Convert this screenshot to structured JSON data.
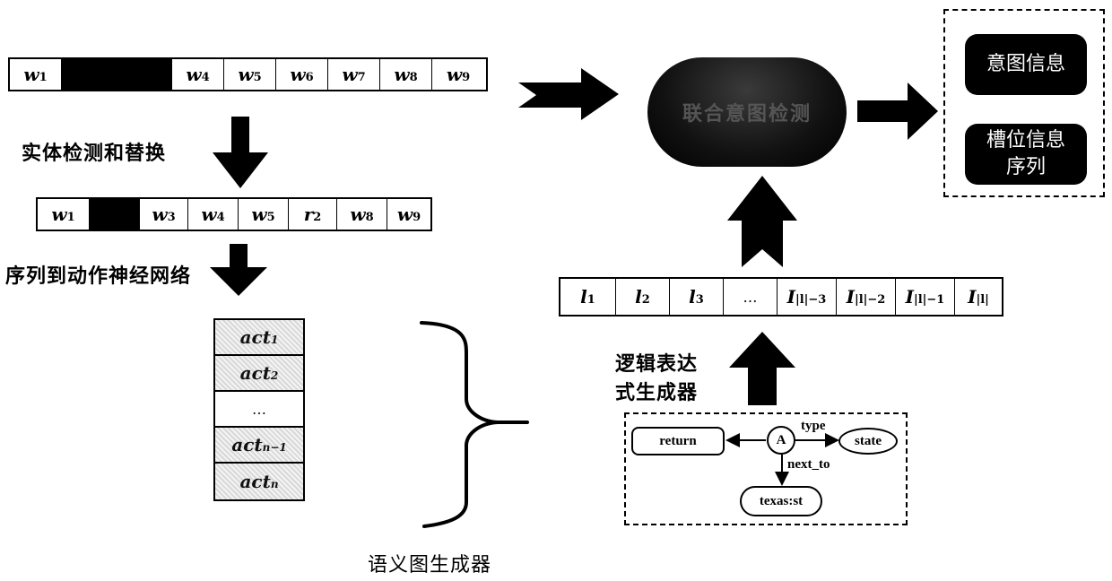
{
  "input_sequence": {
    "cells": [
      {
        "base": "w",
        "sub": "1",
        "masked": false
      },
      {
        "base": "",
        "sub": "",
        "masked": true
      },
      {
        "base": "w",
        "sub": "4",
        "masked": false
      },
      {
        "base": "w",
        "sub": "5",
        "masked": false
      },
      {
        "base": "w",
        "sub": "6",
        "masked": false
      },
      {
        "base": "w",
        "sub": "7",
        "masked": false
      },
      {
        "base": "w",
        "sub": "8",
        "masked": false
      },
      {
        "base": "w",
        "sub": "9",
        "masked": false
      }
    ]
  },
  "entity_step": {
    "label": "实体检测和替换"
  },
  "replaced_sequence": {
    "cells": [
      {
        "base": "w",
        "sub": "1",
        "masked": false
      },
      {
        "base": "",
        "sub": "",
        "masked": true
      },
      {
        "base": "w",
        "sub": "3",
        "masked": false
      },
      {
        "base": "w",
        "sub": "4",
        "masked": false
      },
      {
        "base": "w",
        "sub": "5",
        "masked": false
      },
      {
        "base": "r",
        "sub": "2",
        "masked": false
      },
      {
        "base": "w",
        "sub": "8",
        "masked": false
      },
      {
        "base": "w",
        "sub": "9",
        "masked": false
      }
    ]
  },
  "seq2action_step": {
    "label": "序列到动作神经网络"
  },
  "actions": [
    {
      "base": "act",
      "sub": "1",
      "plain": false
    },
    {
      "base": "act",
      "sub": "2",
      "plain": false
    },
    {
      "base": "…",
      "sub": "",
      "plain": true
    },
    {
      "base": "act",
      "sub": "n−1",
      "plain": false
    },
    {
      "base": "act",
      "sub": "n",
      "plain": false
    }
  ],
  "semantic_graph_generator": {
    "label": "语义图生成器"
  },
  "logic_expression_generator": {
    "label_line1": "逻辑表达",
    "label_line2": "式生成器"
  },
  "semantic_graph": {
    "nodes": {
      "return": "return",
      "A": "A",
      "state": "state",
      "texas": "texas:st"
    },
    "edges": {
      "type": "type",
      "next_to": "next_to"
    }
  },
  "logic_sequence": {
    "cells": [
      {
        "base": "l",
        "sub": "1"
      },
      {
        "base": "l",
        "sub": "2"
      },
      {
        "base": "l",
        "sub": "3"
      },
      {
        "base": "…",
        "sub": ""
      },
      {
        "base": "I",
        "sub": "|l|−3"
      },
      {
        "base": "I",
        "sub": "|l|−2"
      },
      {
        "base": "I",
        "sub": "|l|−1"
      },
      {
        "base": "I",
        "sub": "|l|"
      }
    ]
  },
  "joint_detection": {
    "label": "联合意图检测"
  },
  "outputs": {
    "intent": "意图信息",
    "slot_line1": "槽位信息",
    "slot_line2": "序列"
  }
}
